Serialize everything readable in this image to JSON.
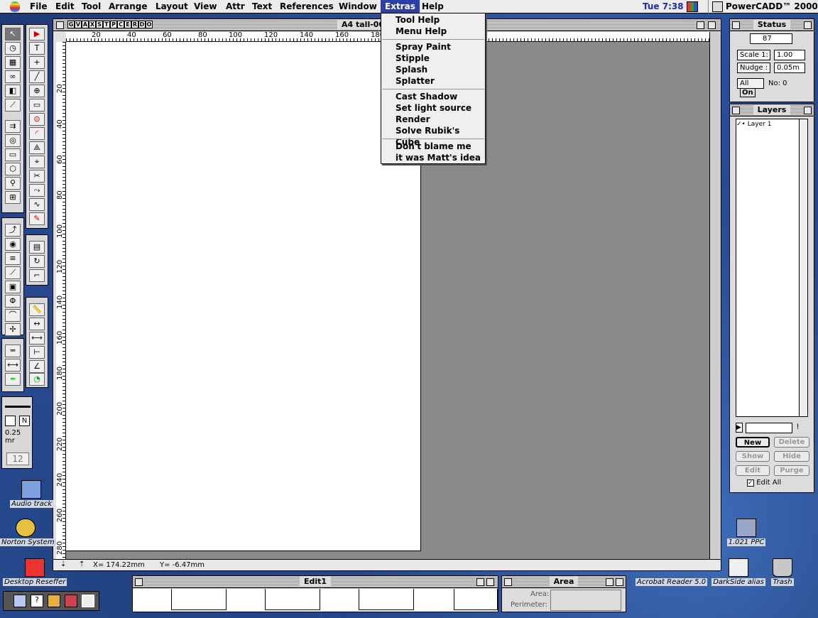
{
  "menubar": {
    "items": [
      "File",
      "Edit",
      "Tool",
      "Arrange",
      "Layout",
      "View",
      "Attr",
      "Text",
      "References",
      "Window",
      "Extras",
      "Help"
    ],
    "active": "Extras",
    "clock": "Tue 7:38",
    "app_name": "PowerCADD™ 2000"
  },
  "extras_menu": {
    "groups": [
      [
        "Tool Help",
        "Menu Help"
      ],
      [
        "Spray Paint",
        "Stipple",
        "Splash",
        "Splatter"
      ],
      [
        "Cast Shadow",
        "Set light source",
        "Render",
        "Solve Rubik's Cube"
      ],
      [
        "Don't blame me",
        "it was Matt's idea"
      ]
    ]
  },
  "document": {
    "title": "A4 tall-00",
    "tab_letters": [
      "G",
      "V",
      "A",
      "X",
      "S",
      "T",
      "P",
      "C",
      "E",
      "R",
      "D",
      "O"
    ],
    "ruler_h": [
      "20",
      "40",
      "60",
      "80",
      "100",
      "120",
      "140",
      "160",
      "180"
    ],
    "ruler_v": [
      "20",
      "40",
      "60",
      "80",
      "100",
      "120",
      "140",
      "160",
      "180",
      "200",
      "220",
      "240",
      "260",
      "280"
    ],
    "status_x": "X= 174.22mm",
    "status_y": "Y= -6.47mm"
  },
  "status_palette": {
    "title": "Status",
    "value": "87",
    "scale_label": "Scale 1:",
    "scale_value": "1.00",
    "nudge_label": "Nudge :",
    "nudge_value": "0.05m",
    "all_label": "All",
    "on_label": "On",
    "no_label": "No: 0"
  },
  "layers_palette": {
    "title": "Layers",
    "layer_name": "Layer 1",
    "buttons": {
      "new": "New",
      "delete": "Delete",
      "show": "Show",
      "hide": "Hide",
      "edit": "Edit",
      "purge": "Purge"
    },
    "edit_all": "Edit All"
  },
  "pen_palette": {
    "n_label": "N",
    "line_weight": "0.25 mr",
    "size_value": "12"
  },
  "edit_palette": {
    "title": "Edit1"
  },
  "area_palette": {
    "title": "Area",
    "area_label": "Area:",
    "perimeter_label": "Perimeter:"
  },
  "desktop_icons": [
    "Audio track",
    "Norton System",
    "Desktop Reseffer",
    "Acrobat Reader 5.0",
    "DarkSide alias",
    "Trash",
    "1.021 PPC"
  ],
  "colors": {
    "menu_highlight": "#2f3fa8",
    "clock": "#1a2ab0",
    "canvas_bg": "#8a8a8a"
  }
}
